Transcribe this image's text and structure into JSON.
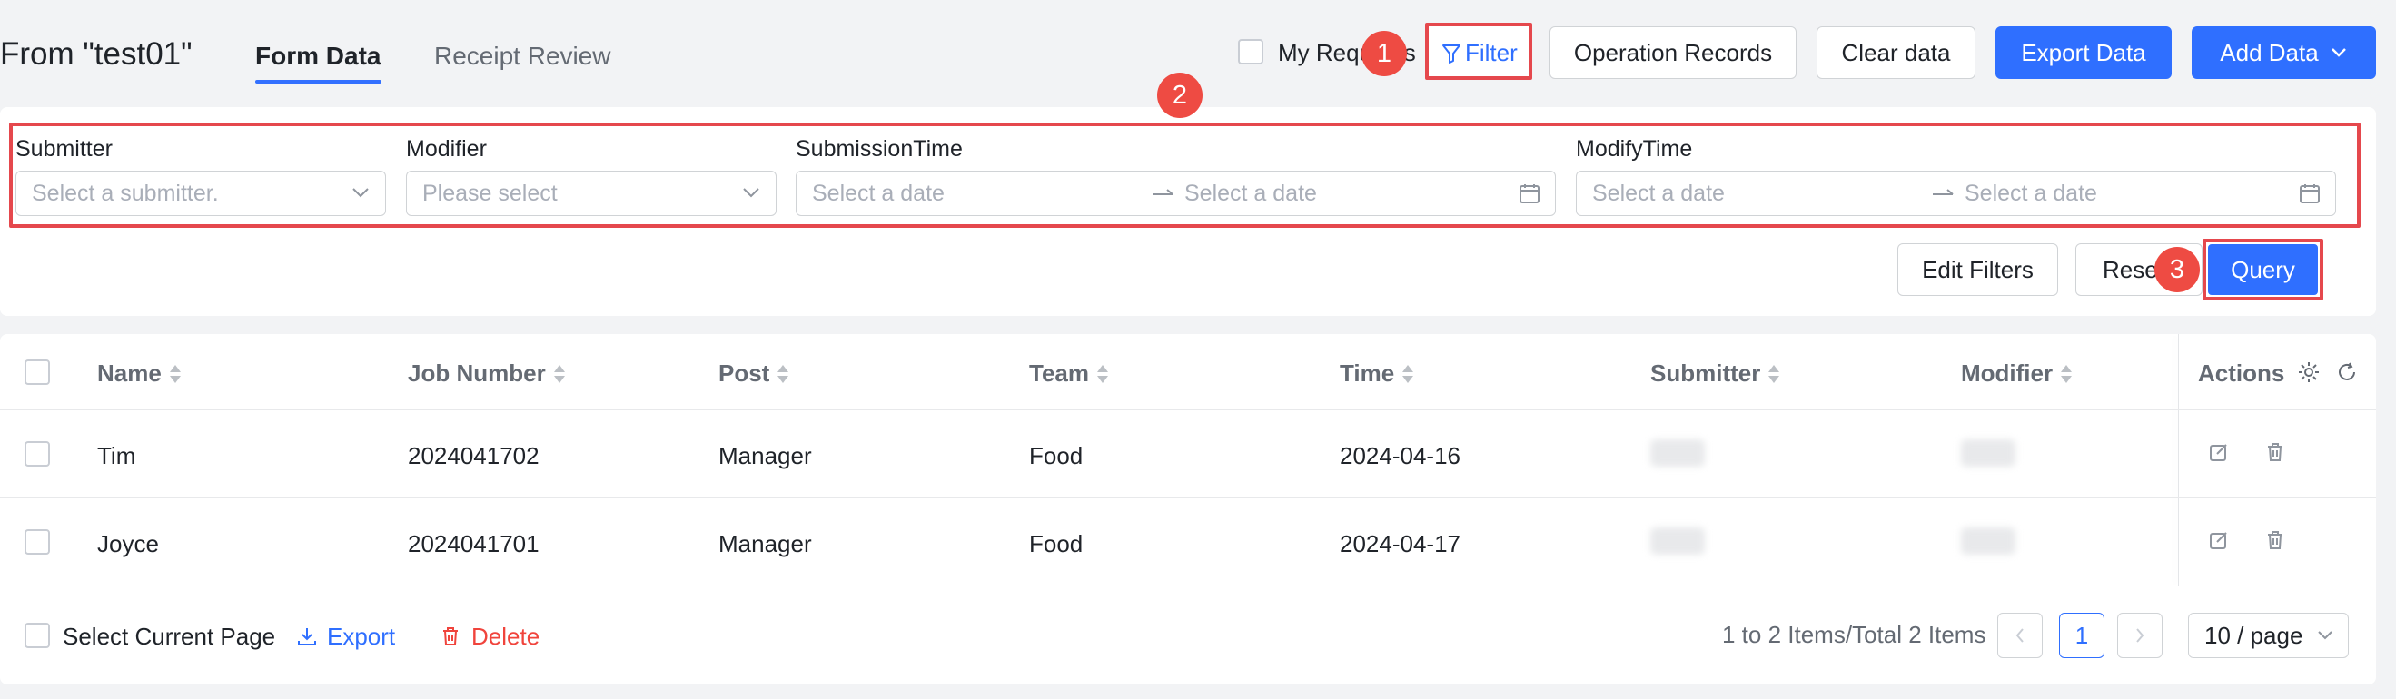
{
  "header": {
    "title": "From \"test01\"",
    "tabs": [
      {
        "label": "Form Data",
        "active": true
      },
      {
        "label": "Receipt Review",
        "active": false
      }
    ],
    "my_requests_label": "My Requests",
    "filter_label": "Filter",
    "buttons": {
      "operation_records": "Operation Records",
      "clear_data": "Clear data",
      "export_data": "Export Data",
      "add_data": "Add Data"
    }
  },
  "badges": [
    "1",
    "2",
    "3"
  ],
  "filters": {
    "submitter": {
      "label": "Submitter",
      "placeholder": "Select a submitter."
    },
    "modifier": {
      "label": "Modifier",
      "placeholder": "Please select"
    },
    "submission_time": {
      "label": "SubmissionTime",
      "start_placeholder": "Select a date",
      "end_placeholder": "Select a date"
    },
    "modify_time": {
      "label": "ModifyTime",
      "start_placeholder": "Select a date",
      "end_placeholder": "Select a date"
    },
    "edit_filters": "Edit Filters",
    "reset": "Reset",
    "query": "Query"
  },
  "table": {
    "columns": [
      "Name",
      "Job Number",
      "Post",
      "Team",
      "Time",
      "Submitter",
      "Modifier"
    ],
    "actions_header": "Actions",
    "rows": [
      {
        "name": "Tim",
        "job_number": "2024041702",
        "post": "Manager",
        "team": "Food",
        "time": "2024-04-16"
      },
      {
        "name": "Joyce",
        "job_number": "2024041701",
        "post": "Manager",
        "team": "Food",
        "time": "2024-04-17"
      }
    ]
  },
  "footer": {
    "select_page": "Select Current Page",
    "export": "Export",
    "delete": "Delete",
    "summary": "1 to 2 Items/Total 2 Items",
    "current_page": "1",
    "page_size": "10 / page"
  },
  "colors": {
    "accent": "#2f6fff",
    "danger": "#f0443c",
    "highlight": "#e5484d"
  }
}
